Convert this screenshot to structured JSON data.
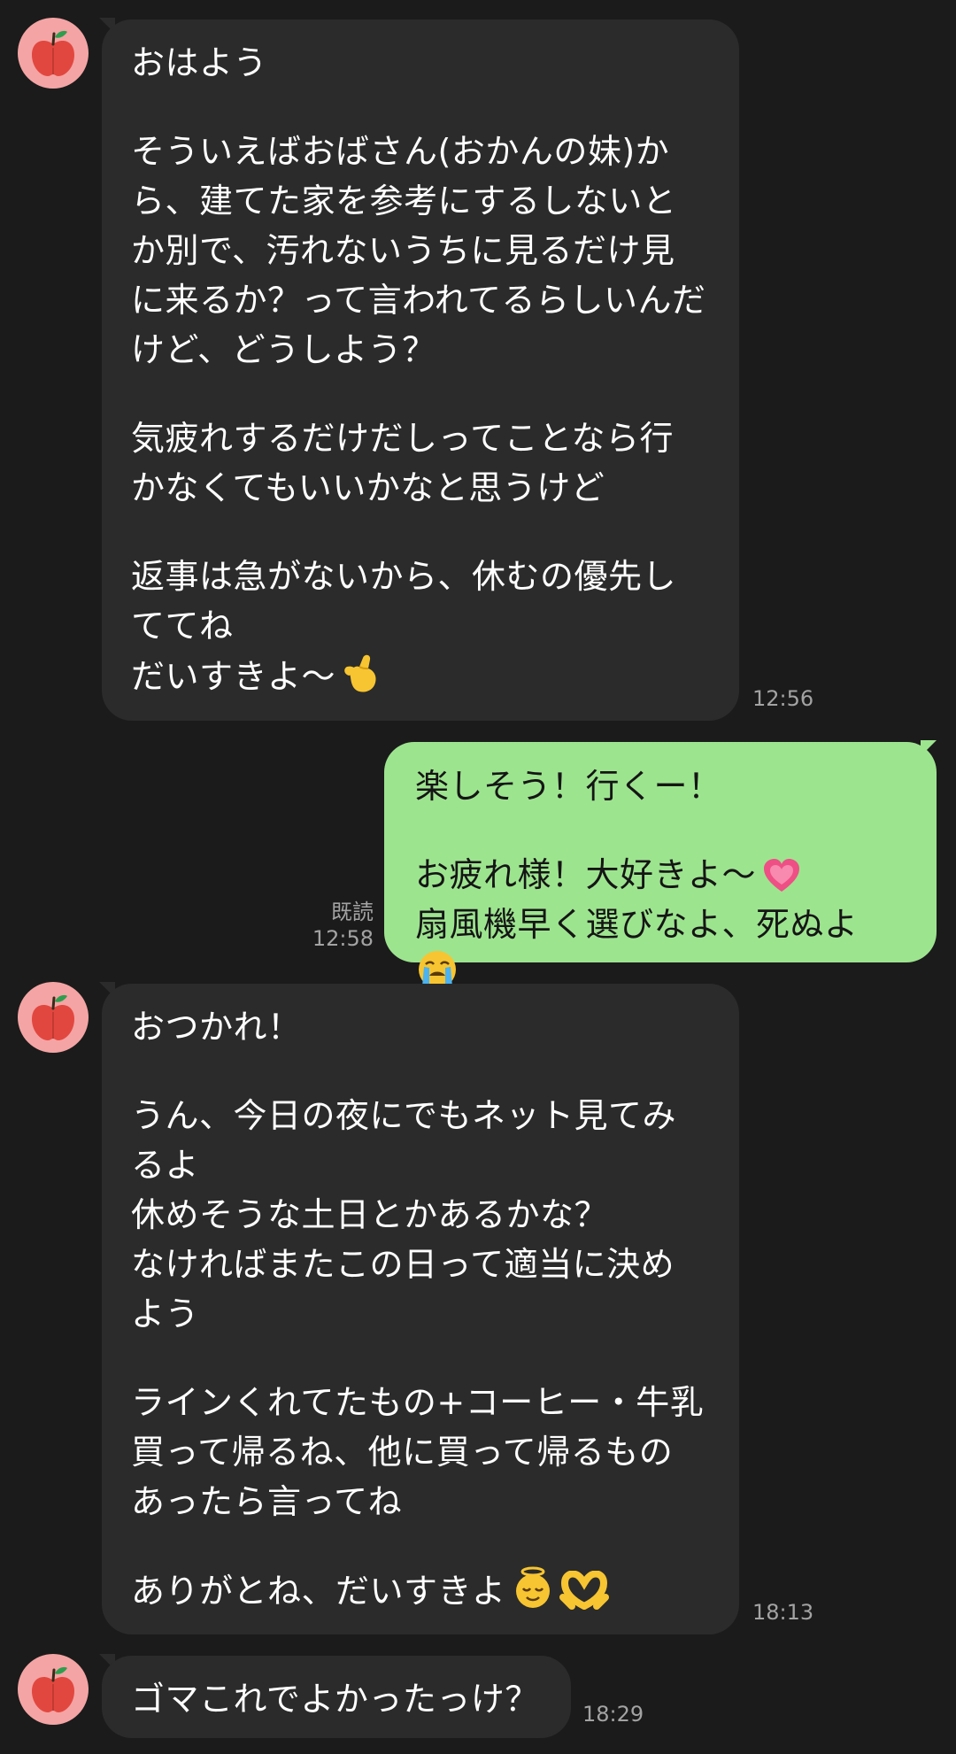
{
  "messages": [
    {
      "direction": "incoming",
      "avatar_icon": "apple-icon",
      "paragraphs": [
        "おはよう",
        "そういえばおばさん(おかんの妹)か\nら、建てた家を参考にするしないと\nか別で、汚れないうちに見るだけ見\nに来るか？って言われてるらしいんだ\nけど、どうしよう？",
        "気疲れするだけだしってことなら行\nかなくてもいいかなと思うけど",
        "返事は急がないから、休むの優先し\nててね\nだいすきよ〜"
      ],
      "trailing_emoji": "finger-heart-emoji",
      "time": "12:56"
    },
    {
      "direction": "outgoing",
      "paragraphs": [
        "楽しそう！行くー！",
        "お疲れ様！大好きよ〜",
        "扇風機早く選びなよ、死ぬよ"
      ],
      "emojis": [
        "heart-emoji",
        "crying-face-emoji"
      ],
      "read_label": "既読",
      "time": "12:58"
    },
    {
      "direction": "incoming",
      "avatar_icon": "apple-icon",
      "paragraphs": [
        "おつかれ！",
        "うん、今日の夜にでもネット見てみ\nるよ\n休めそうな土日とかあるかな？\nなければまたこの日って適当に決め\nよう",
        "ラインくれてたもの+コーヒー・牛乳\n買って帰るね、他に買って帰るもの\nあったら言ってね",
        "ありがとね、だいすきよ"
      ],
      "emojis": [
        "angel-face-emoji",
        "heart-hands-emoji"
      ],
      "time": "18:13"
    },
    {
      "direction": "incoming",
      "avatar_icon": "apple-icon",
      "paragraphs": [
        "ゴマこれでよかったっけ？"
      ],
      "time": "18:29"
    }
  ],
  "colors": {
    "background": "#1b1b1b",
    "incoming_bubble": "#2b2b2b",
    "outgoing_bubble": "#9de48f",
    "timestamp": "#a3a3a3",
    "avatar_bg": "#f4a4a4"
  }
}
